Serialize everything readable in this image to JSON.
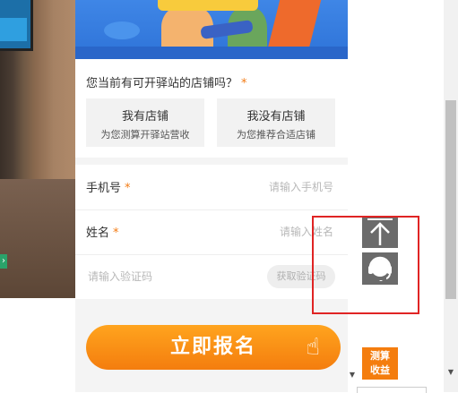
{
  "form": {
    "question": "您当前有可开驿站的店铺吗？",
    "required_mark": "*",
    "option_have": {
      "title": "我有店铺",
      "subtitle": "为您测算开驿站营收"
    },
    "option_none": {
      "title": "我没有店铺",
      "subtitle": "为您推荐合适店铺"
    },
    "phone": {
      "label": "手机号",
      "placeholder": "请输入手机号"
    },
    "name": {
      "label": "姓名",
      "placeholder": "请输入姓名"
    },
    "code": {
      "placeholder": "请输入验证码",
      "button": "获取验证码"
    },
    "submit": "立即报名"
  },
  "floating": {
    "back_to_top_icon": "arrow-up-icon",
    "service_icon": "headset-icon",
    "calc_badge_line1": "测算",
    "calc_badge_line2": "收益"
  },
  "colors": {
    "accent": "#f47d0e",
    "highlight": "#e02424",
    "float_bg": "#6b6b6b",
    "banner": "#2e73d8"
  }
}
